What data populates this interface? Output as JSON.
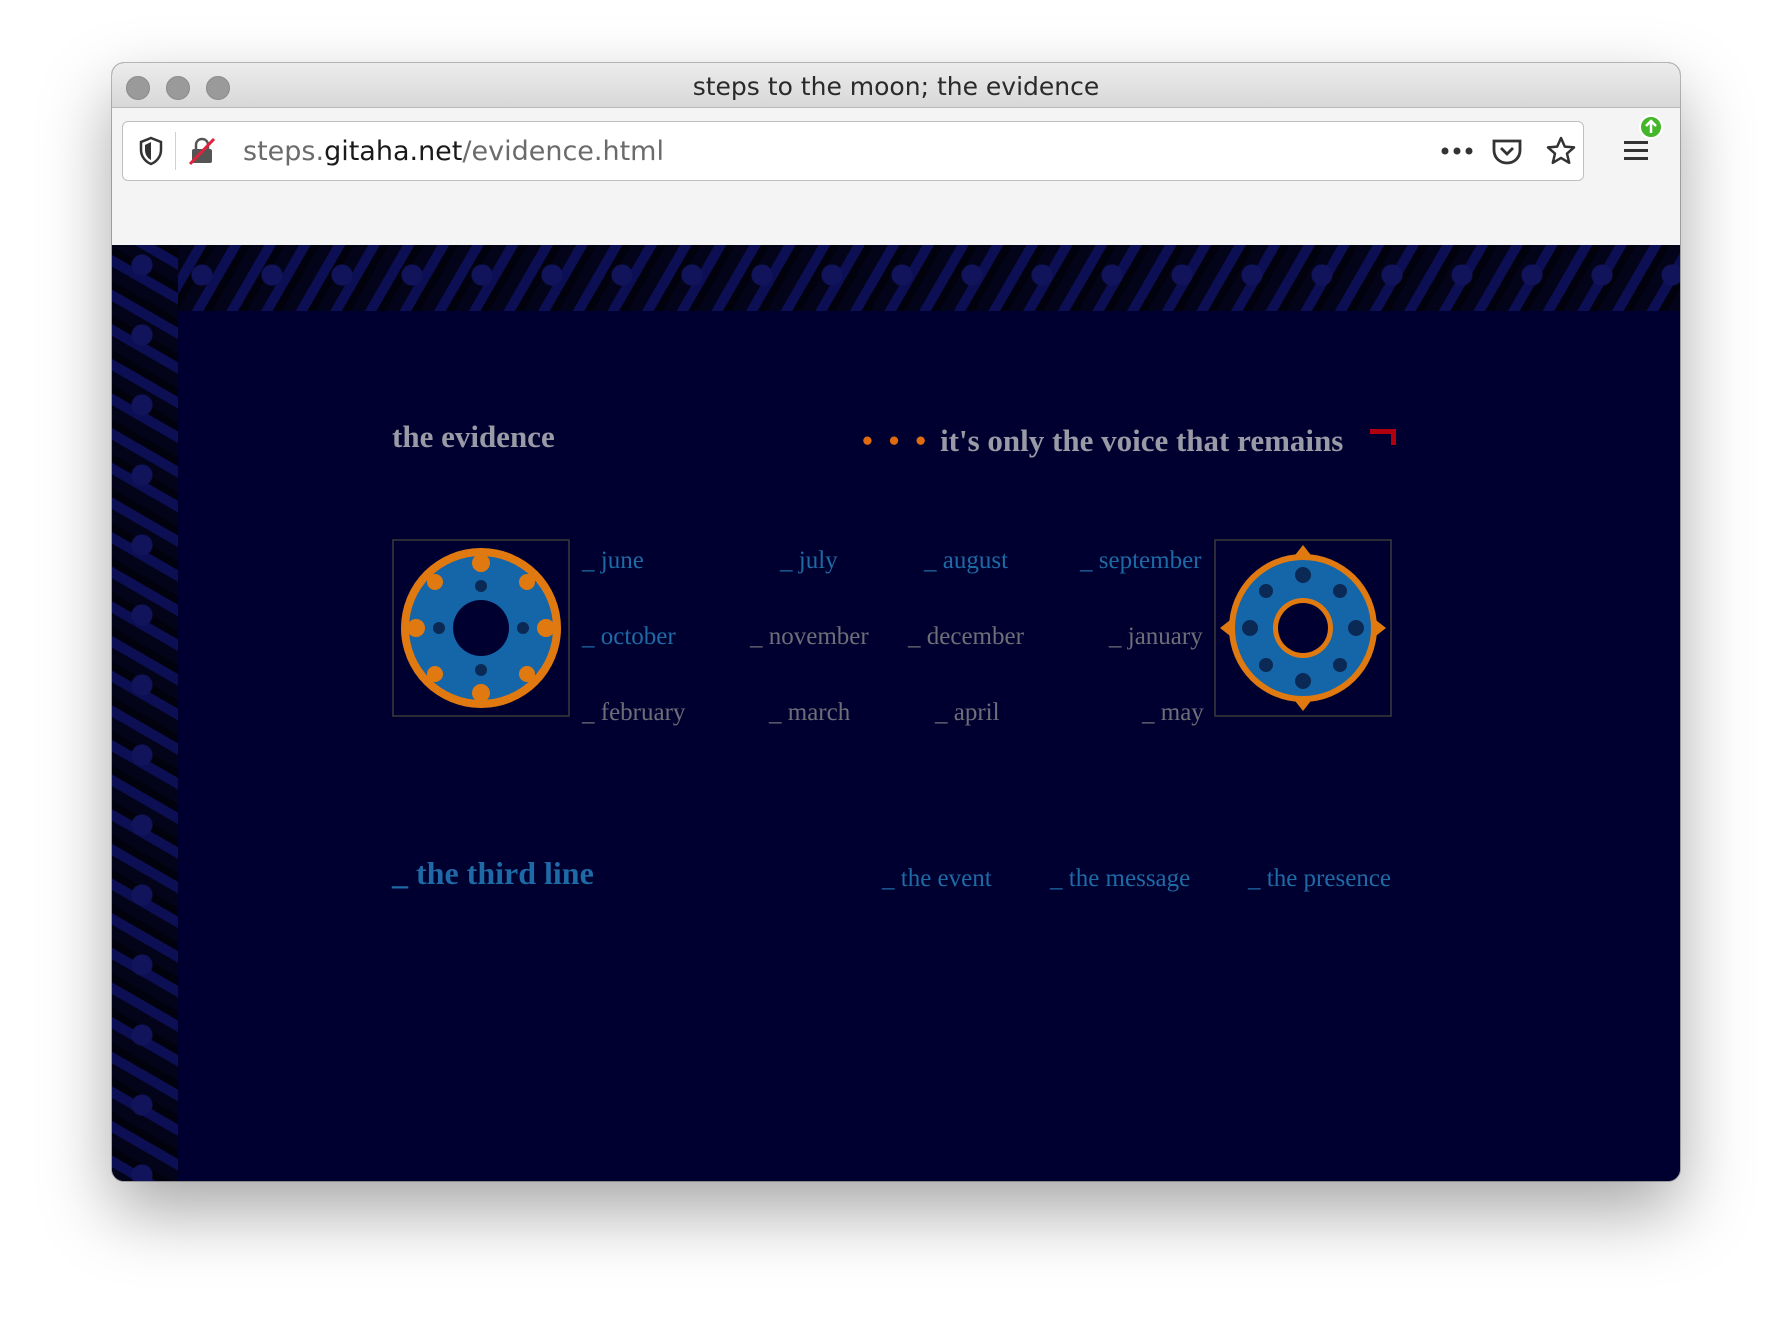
{
  "window": {
    "title": "steps to the moon; the evidence"
  },
  "toolbar": {
    "url_prefix": "steps.",
    "url_domain": "gitaha.net",
    "url_path": "/evidence.html",
    "icons": [
      "shield-icon",
      "insecure-lock-icon",
      "more-icon",
      "pocket-icon",
      "bookmark-star-icon",
      "menu-icon",
      "update-badge-icon"
    ]
  },
  "page": {
    "heading": "the evidence",
    "tagline_dots": "• • •",
    "tagline": "it's only the voice that remains",
    "months": [
      {
        "label": "_ june",
        "state": "active"
      },
      {
        "label": "_ july",
        "state": "active"
      },
      {
        "label": "_ august",
        "state": "active"
      },
      {
        "label": "_ september",
        "state": "active"
      },
      {
        "label": "_ october",
        "state": "active"
      },
      {
        "label": "_ november",
        "state": "dim"
      },
      {
        "label": "_ december",
        "state": "dim"
      },
      {
        "label": "_ january",
        "state": "dim"
      },
      {
        "label": "_ february",
        "state": "dim"
      },
      {
        "label": "_ march",
        "state": "dim"
      },
      {
        "label": "_ april",
        "state": "dim"
      },
      {
        "label": "_ may",
        "state": "dim"
      }
    ],
    "third_line": "_ the third line",
    "links": {
      "event": "_ the event",
      "message": "_ the message",
      "presence": "_ the presence"
    }
  },
  "colors": {
    "background": "#000030",
    "link_active": "#1e6aa6",
    "link_dim": "#6e6e78",
    "heading": "#9a9aa6",
    "accent_orange": "#e06a10",
    "accent_red": "#b00010"
  }
}
